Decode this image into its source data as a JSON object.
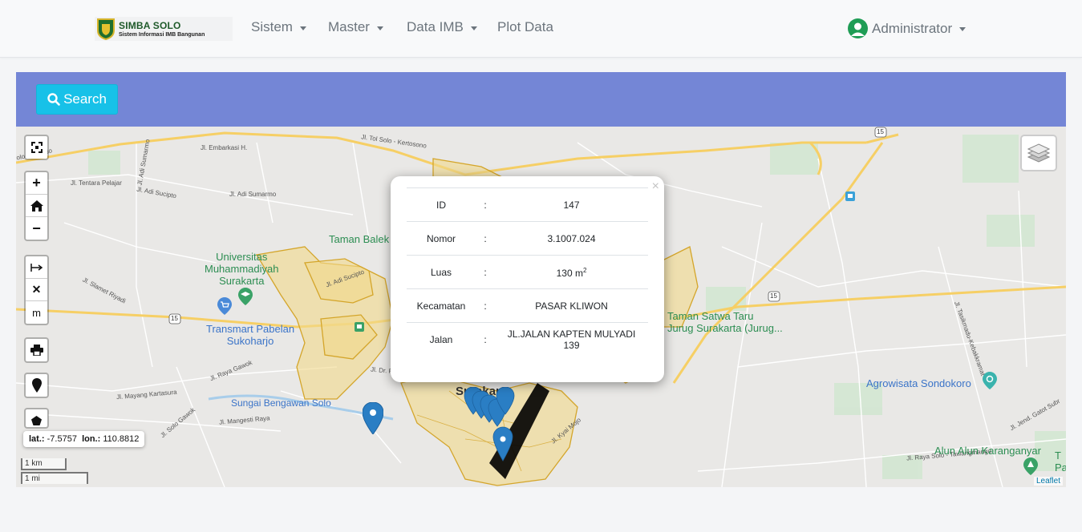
{
  "brand": {
    "title": "SIMBA SOLO",
    "subtitle": "Sistem Informasi IMB Bangunan"
  },
  "nav": {
    "items": [
      {
        "label": "Sistem"
      },
      {
        "label": "Master"
      },
      {
        "label": "Data IMB"
      },
      {
        "label": "Plot Data"
      }
    ],
    "user": "Administrator"
  },
  "search": {
    "label": "Search"
  },
  "map": {
    "controls": {
      "zoom_in": "+",
      "zoom_out": "−",
      "clear": "✕",
      "measure_unit": "m"
    },
    "coords": {
      "lat_label": "lat.:",
      "lat": "-7.5757",
      "lon_label": "lon.:",
      "lon": "110.8812"
    },
    "scale": {
      "metric": "1 km",
      "imperial": "1 mi"
    },
    "attribution": "Leaflet",
    "places": {
      "taman_balekambang": "Taman Balek",
      "ums": "Universitas\nMuhammadiyah\nSurakarta",
      "transmart": "Transmart Pabelan\nSukoharjo",
      "bengawan": "Sungai Bengawan Solo",
      "taman_satwa": "Taman Satwa Taru\nJurug Surakarta (Jurug...",
      "agrowisata": "Agrowisata Sondokoro",
      "alun": "Alun Alun Karanganyar",
      "alun_cut": "T\nPa",
      "surakarta": "Surakar"
    },
    "roads": {
      "tol": "Jl. Tol Solo - Kertosono",
      "tol_left": "olo - Kertoso",
      "embarkasi": "Jl. Embarkasi H.",
      "tentara": "Jl. Tentara Pelajar",
      "adi_sucipto": "Jl. Adi Sucipto",
      "adi_sumarmo": "Jl. Adi Sumarmo",
      "adi_sumarmo_v": "Jl. Adi Sumarmo",
      "slamet": "Jl. Slamet Riyadi",
      "raya_gawok": "Jl. Raya Gawok",
      "mayang": "Jl. Mayang Kartasura",
      "mangesti": "Jl. Mangesti Raya",
      "solo_gawok": "Jl. Solo Gawok",
      "dr_ra": "Jl. Dr. Ra",
      "kyai_mojo": "Jl. Kyai Mojo",
      "adi_supto": "Jl. Adi Sucipto",
      "tawangmangu": "Jl. Raya Solo - Tawangmangu",
      "jend_gatot": "Jl. Jend. Gatot Subr",
      "kebakkramat": "Jl. Tasikmadu-Kebakkramat"
    },
    "route_15": "15"
  },
  "popup": {
    "close": "×",
    "rows": [
      {
        "key": "ID",
        "sep": ":",
        "value": "147"
      },
      {
        "key": "Nomor",
        "sep": ":",
        "value": "3.1007.024"
      },
      {
        "key": "Luas",
        "sep": ":",
        "value": "130 m",
        "sup": "2"
      },
      {
        "key": "Kecamatan",
        "sep": ":",
        "value": "PASAR KLIWON"
      },
      {
        "key": "Jalan",
        "sep": ":",
        "value": "JL.JALAN KAPTEN MULYADI 139"
      }
    ]
  },
  "colors": {
    "accent_panel": "#7486d6",
    "search_button": "#17c1e8",
    "polygon_fill": "#f1d98a",
    "polygon_stroke": "#d4a52a",
    "marker": "#2a7ec4"
  }
}
